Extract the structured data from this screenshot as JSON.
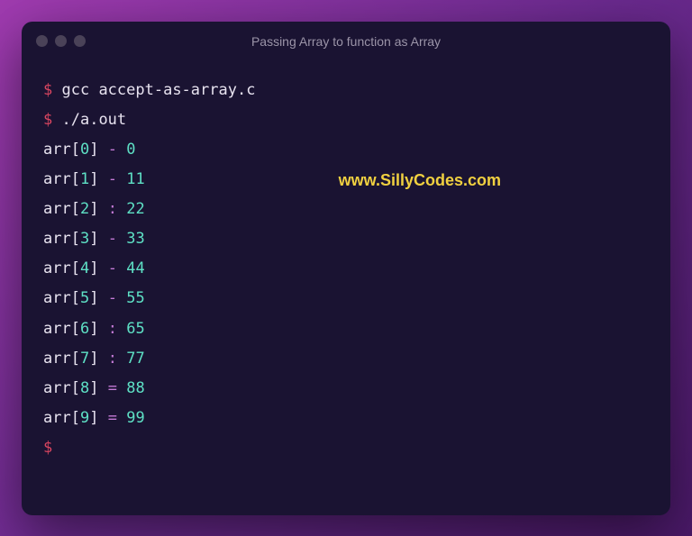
{
  "window": {
    "title": "Passing Array to function as Array"
  },
  "watermark": "www.SillyCodes.com",
  "commands": [
    {
      "prompt": "$",
      "text": "gcc accept-as-array.c"
    },
    {
      "prompt": "$",
      "text": "./a.out"
    }
  ],
  "output": [
    {
      "name": "arr",
      "index": "0",
      "op": "-",
      "value": "0"
    },
    {
      "name": "arr",
      "index": "1",
      "op": "-",
      "value": "11"
    },
    {
      "name": "arr",
      "index": "2",
      "op": ":",
      "value": "22"
    },
    {
      "name": "arr",
      "index": "3",
      "op": "-",
      "value": "33"
    },
    {
      "name": "arr",
      "index": "4",
      "op": "-",
      "value": "44"
    },
    {
      "name": "arr",
      "index": "5",
      "op": "-",
      "value": "55"
    },
    {
      "name": "arr",
      "index": "6",
      "op": ":",
      "value": "65"
    },
    {
      "name": "arr",
      "index": "7",
      "op": ":",
      "value": "77"
    },
    {
      "name": "arr",
      "index": "8",
      "op": "=",
      "value": "88"
    },
    {
      "name": "arr",
      "index": "9",
      "op": "=",
      "value": "99"
    }
  ],
  "final_prompt": "$"
}
